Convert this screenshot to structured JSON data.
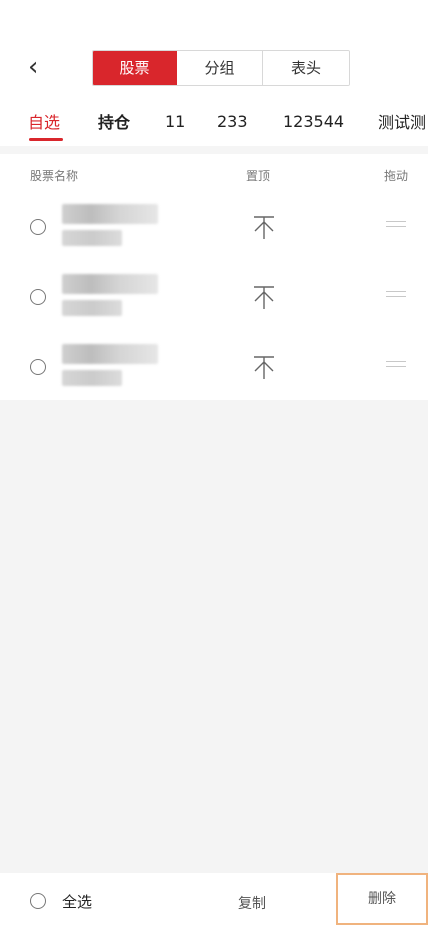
{
  "nav": {
    "back_icon": "‹",
    "segments": [
      {
        "label": "股票",
        "active": true
      },
      {
        "label": "分组",
        "active": false
      },
      {
        "label": "表头",
        "active": false
      }
    ]
  },
  "tabs": [
    {
      "label": "自选",
      "active": true
    },
    {
      "label": "持仓",
      "active": false
    },
    {
      "label": "11",
      "active": false
    },
    {
      "label": "233",
      "active": false
    },
    {
      "label": "123544",
      "active": false
    },
    {
      "label": "测试测",
      "active": false
    }
  ],
  "table_header": {
    "name": "股票名称",
    "pin": "置顶",
    "drag": "拖动"
  },
  "rows": [
    {
      "pin_icon": "不"
    },
    {
      "pin_icon": "不"
    },
    {
      "pin_icon": "不"
    }
  ],
  "bottom": {
    "select_all": "全选",
    "copy": "复制",
    "delete": "删除"
  },
  "colors": {
    "accent": "#d9262c",
    "highlight_border": "#f0b37e"
  }
}
